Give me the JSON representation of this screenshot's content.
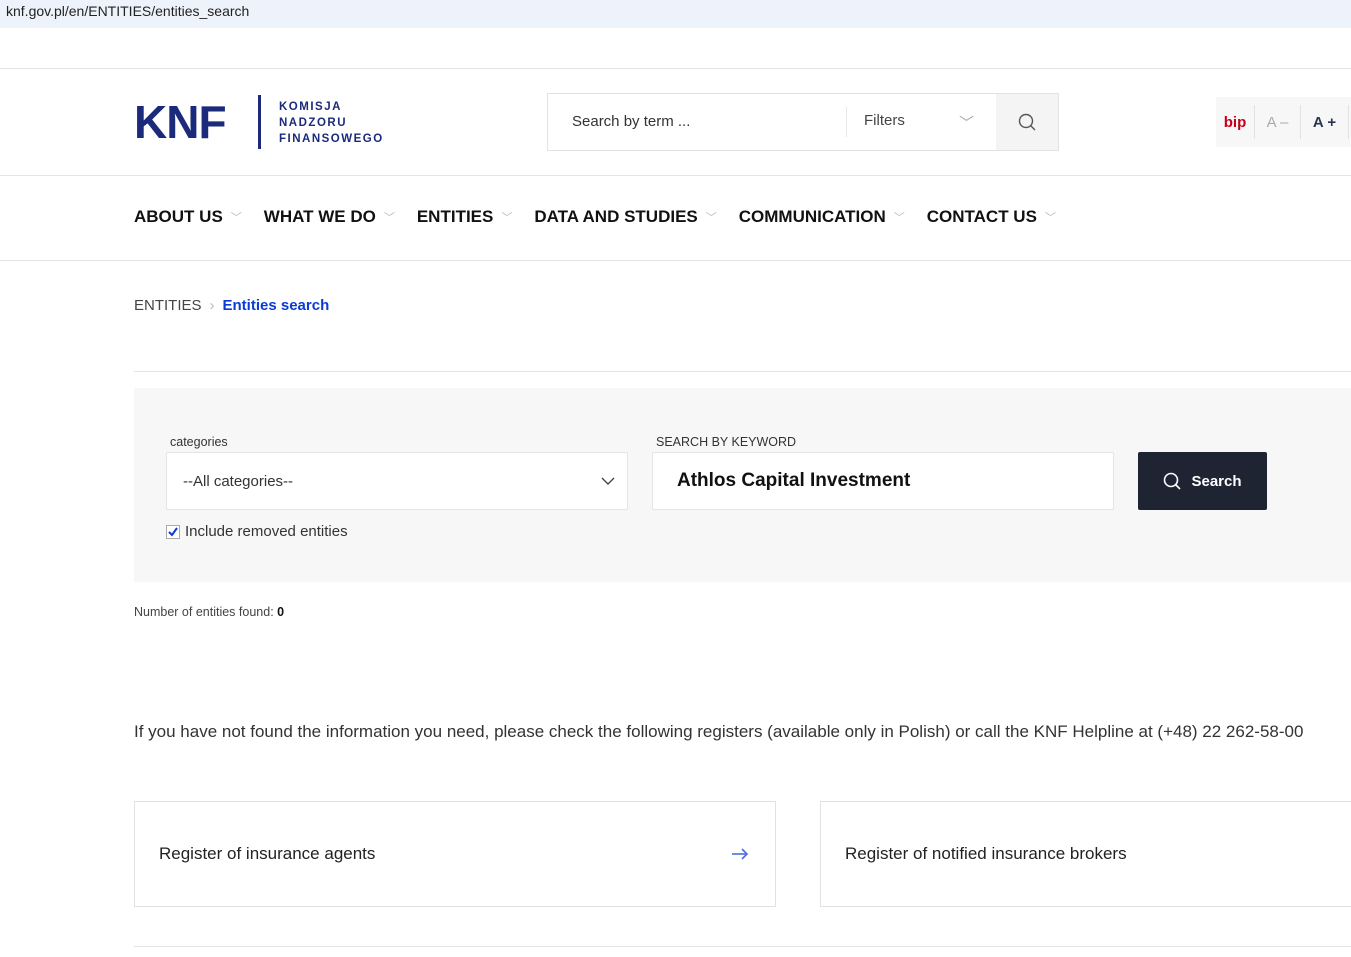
{
  "url": "knf.gov.pl/en/ENTITIES/entities_search",
  "logo": {
    "mark": "KNF",
    "line1": "KOMISJA",
    "line2": "NADZORU",
    "line3": "FINANSOWEGO"
  },
  "header_search": {
    "placeholder": "Search by term ...",
    "filters_label": "Filters"
  },
  "tools": {
    "bip": "bip",
    "decrease": "A –",
    "increase": "A +"
  },
  "nav": [
    "ABOUT US",
    "WHAT WE DO",
    "ENTITIES",
    "DATA AND STUDIES",
    "COMMUNICATION",
    "CONTACT US"
  ],
  "breadcrumb": {
    "parent": "ENTITIES",
    "current": "Entities search"
  },
  "form": {
    "categories_label": "categories",
    "categories_value": "--All categories--",
    "keyword_label": "SEARCH BY KEYWORD",
    "keyword_value": "Athlos Capital Investment",
    "search_button": "Search",
    "include_removed_label": "Include removed entities",
    "include_removed_checked": true
  },
  "results": {
    "label": "Number of entities found:",
    "count": "0"
  },
  "info_text": "If you have not found the information you need, please check the following registers (available only in Polish) or call the KNF Helpline at (+48) 22 262-58-00",
  "cards": [
    "Register of insurance agents",
    "Register of notified insurance brokers"
  ],
  "colors": {
    "brand": "#1b2a7a",
    "link": "#0a3bd6",
    "button": "#1f2433",
    "bip": "#c4001a"
  }
}
